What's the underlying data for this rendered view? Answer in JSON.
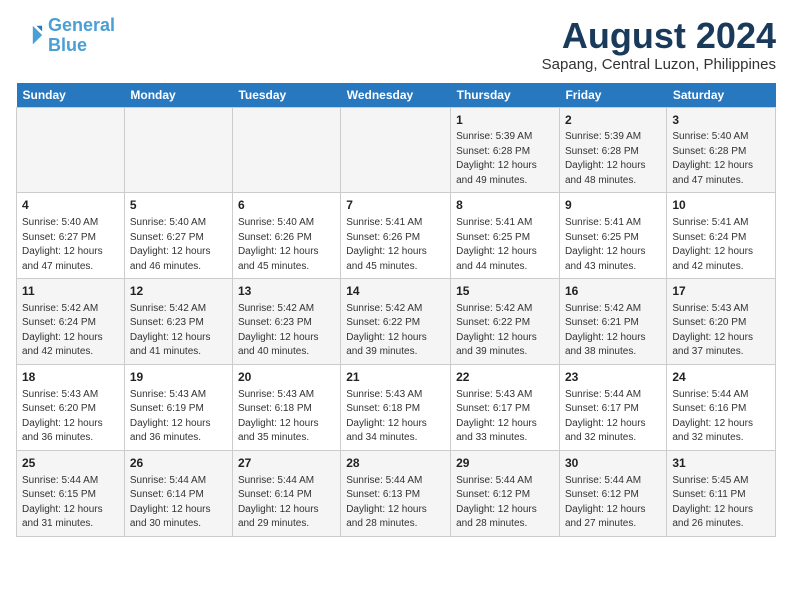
{
  "logo": {
    "line1": "General",
    "line2": "Blue"
  },
  "title": "August 2024",
  "location": "Sapang, Central Luzon, Philippines",
  "days_of_week": [
    "Sunday",
    "Monday",
    "Tuesday",
    "Wednesday",
    "Thursday",
    "Friday",
    "Saturday"
  ],
  "weeks": [
    [
      {
        "day": "",
        "content": ""
      },
      {
        "day": "",
        "content": ""
      },
      {
        "day": "",
        "content": ""
      },
      {
        "day": "",
        "content": ""
      },
      {
        "day": "1",
        "content": "Sunrise: 5:39 AM\nSunset: 6:28 PM\nDaylight: 12 hours\nand 49 minutes."
      },
      {
        "day": "2",
        "content": "Sunrise: 5:39 AM\nSunset: 6:28 PM\nDaylight: 12 hours\nand 48 minutes."
      },
      {
        "day": "3",
        "content": "Sunrise: 5:40 AM\nSunset: 6:28 PM\nDaylight: 12 hours\nand 47 minutes."
      }
    ],
    [
      {
        "day": "4",
        "content": "Sunrise: 5:40 AM\nSunset: 6:27 PM\nDaylight: 12 hours\nand 47 minutes."
      },
      {
        "day": "5",
        "content": "Sunrise: 5:40 AM\nSunset: 6:27 PM\nDaylight: 12 hours\nand 46 minutes."
      },
      {
        "day": "6",
        "content": "Sunrise: 5:40 AM\nSunset: 6:26 PM\nDaylight: 12 hours\nand 45 minutes."
      },
      {
        "day": "7",
        "content": "Sunrise: 5:41 AM\nSunset: 6:26 PM\nDaylight: 12 hours\nand 45 minutes."
      },
      {
        "day": "8",
        "content": "Sunrise: 5:41 AM\nSunset: 6:25 PM\nDaylight: 12 hours\nand 44 minutes."
      },
      {
        "day": "9",
        "content": "Sunrise: 5:41 AM\nSunset: 6:25 PM\nDaylight: 12 hours\nand 43 minutes."
      },
      {
        "day": "10",
        "content": "Sunrise: 5:41 AM\nSunset: 6:24 PM\nDaylight: 12 hours\nand 42 minutes."
      }
    ],
    [
      {
        "day": "11",
        "content": "Sunrise: 5:42 AM\nSunset: 6:24 PM\nDaylight: 12 hours\nand 42 minutes."
      },
      {
        "day": "12",
        "content": "Sunrise: 5:42 AM\nSunset: 6:23 PM\nDaylight: 12 hours\nand 41 minutes."
      },
      {
        "day": "13",
        "content": "Sunrise: 5:42 AM\nSunset: 6:23 PM\nDaylight: 12 hours\nand 40 minutes."
      },
      {
        "day": "14",
        "content": "Sunrise: 5:42 AM\nSunset: 6:22 PM\nDaylight: 12 hours\nand 39 minutes."
      },
      {
        "day": "15",
        "content": "Sunrise: 5:42 AM\nSunset: 6:22 PM\nDaylight: 12 hours\nand 39 minutes."
      },
      {
        "day": "16",
        "content": "Sunrise: 5:42 AM\nSunset: 6:21 PM\nDaylight: 12 hours\nand 38 minutes."
      },
      {
        "day": "17",
        "content": "Sunrise: 5:43 AM\nSunset: 6:20 PM\nDaylight: 12 hours\nand 37 minutes."
      }
    ],
    [
      {
        "day": "18",
        "content": "Sunrise: 5:43 AM\nSunset: 6:20 PM\nDaylight: 12 hours\nand 36 minutes."
      },
      {
        "day": "19",
        "content": "Sunrise: 5:43 AM\nSunset: 6:19 PM\nDaylight: 12 hours\nand 36 minutes."
      },
      {
        "day": "20",
        "content": "Sunrise: 5:43 AM\nSunset: 6:18 PM\nDaylight: 12 hours\nand 35 minutes."
      },
      {
        "day": "21",
        "content": "Sunrise: 5:43 AM\nSunset: 6:18 PM\nDaylight: 12 hours\nand 34 minutes."
      },
      {
        "day": "22",
        "content": "Sunrise: 5:43 AM\nSunset: 6:17 PM\nDaylight: 12 hours\nand 33 minutes."
      },
      {
        "day": "23",
        "content": "Sunrise: 5:44 AM\nSunset: 6:17 PM\nDaylight: 12 hours\nand 32 minutes."
      },
      {
        "day": "24",
        "content": "Sunrise: 5:44 AM\nSunset: 6:16 PM\nDaylight: 12 hours\nand 32 minutes."
      }
    ],
    [
      {
        "day": "25",
        "content": "Sunrise: 5:44 AM\nSunset: 6:15 PM\nDaylight: 12 hours\nand 31 minutes."
      },
      {
        "day": "26",
        "content": "Sunrise: 5:44 AM\nSunset: 6:14 PM\nDaylight: 12 hours\nand 30 minutes."
      },
      {
        "day": "27",
        "content": "Sunrise: 5:44 AM\nSunset: 6:14 PM\nDaylight: 12 hours\nand 29 minutes."
      },
      {
        "day": "28",
        "content": "Sunrise: 5:44 AM\nSunset: 6:13 PM\nDaylight: 12 hours\nand 28 minutes."
      },
      {
        "day": "29",
        "content": "Sunrise: 5:44 AM\nSunset: 6:12 PM\nDaylight: 12 hours\nand 28 minutes."
      },
      {
        "day": "30",
        "content": "Sunrise: 5:44 AM\nSunset: 6:12 PM\nDaylight: 12 hours\nand 27 minutes."
      },
      {
        "day": "31",
        "content": "Sunrise: 5:45 AM\nSunset: 6:11 PM\nDaylight: 12 hours\nand 26 minutes."
      }
    ]
  ]
}
